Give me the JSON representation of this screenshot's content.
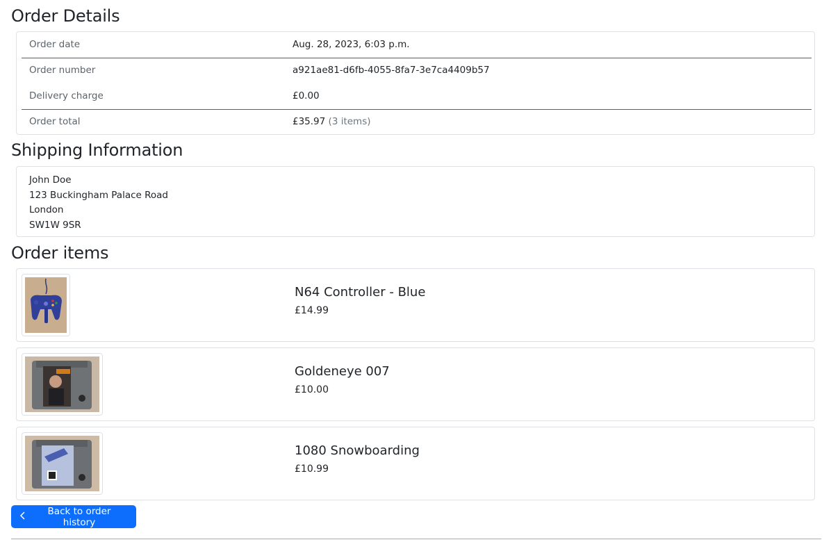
{
  "sections": {
    "details_title": "Order Details",
    "shipping_title": "Shipping Information",
    "items_title": "Order items"
  },
  "order": {
    "rows": [
      {
        "label": "Order date",
        "value": "Aug. 28, 2023, 6:03 p.m."
      },
      {
        "label": "Order number",
        "value": "a921ae81-d6fb-4055-8fa7-3e7ca4409b57"
      },
      {
        "label": "Delivery charge",
        "value": "£0.00"
      },
      {
        "label": "Order total",
        "value": "£35.97",
        "note": "(3 items)"
      }
    ]
  },
  "shipping": {
    "lines": [
      "John Doe",
      "123 Buckingham Palace Road",
      "London",
      "SW1W 9SR"
    ]
  },
  "items": [
    {
      "name": "N64 Controller - Blue",
      "price": "£14.99",
      "image": "n64-controller-blue-image"
    },
    {
      "name": "Goldeneye 007",
      "price": "£10.00",
      "image": "goldeneye-cartridge-image"
    },
    {
      "name": "1080 Snowboarding",
      "price": "£10.99",
      "image": "1080-snowboarding-cartridge-image"
    }
  ],
  "actions": {
    "back_label": "Back to order history",
    "back_icon": "chevron-left-icon"
  },
  "colors": {
    "primary": "#0d6efd",
    "border": "#dee2e6",
    "label": "#5c636a"
  }
}
